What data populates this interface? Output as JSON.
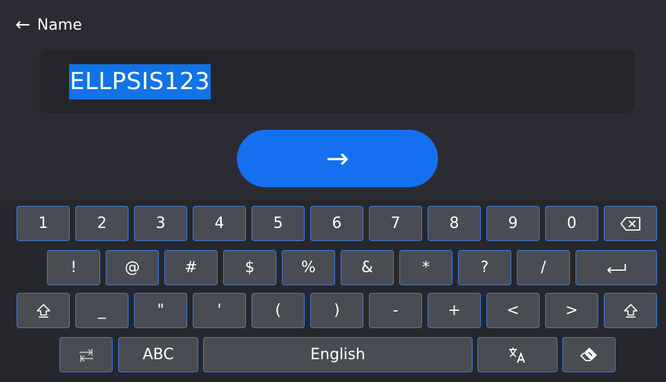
{
  "header": {
    "back_icon": "left-arrow-icon",
    "back_glyph": "←",
    "title": "Name"
  },
  "display": {
    "value": "ELLPSIS123"
  },
  "enter_button": {
    "icon": "right-arrow-icon",
    "glyph": "→"
  },
  "keyboard": {
    "row1": [
      "1",
      "2",
      "3",
      "4",
      "5",
      "6",
      "7",
      "8",
      "9",
      "0"
    ],
    "row1_icons": [
      "backspace-icon"
    ],
    "row2": [
      "!",
      "@",
      "#",
      "$",
      "%",
      "&",
      "*",
      "?",
      "/"
    ],
    "row2_icons": [
      "return-icon"
    ],
    "row3": [
      "_",
      "\"",
      "'",
      "(",
      ")",
      "-",
      "+",
      "<",
      ">"
    ],
    "row3_icons": [
      "shift-icon",
      "shift-icon"
    ],
    "row4": {
      "abc": "ABC",
      "space": "English"
    },
    "row4_icons": [
      "switch-layout-icon",
      "translate-icon",
      "clear-icon"
    ]
  },
  "colors": {
    "background": "#2b2c33",
    "key": "#4a4c53",
    "key_border": "#3b7fe0",
    "accent": "#1570f0",
    "selection": "#1173e6"
  }
}
